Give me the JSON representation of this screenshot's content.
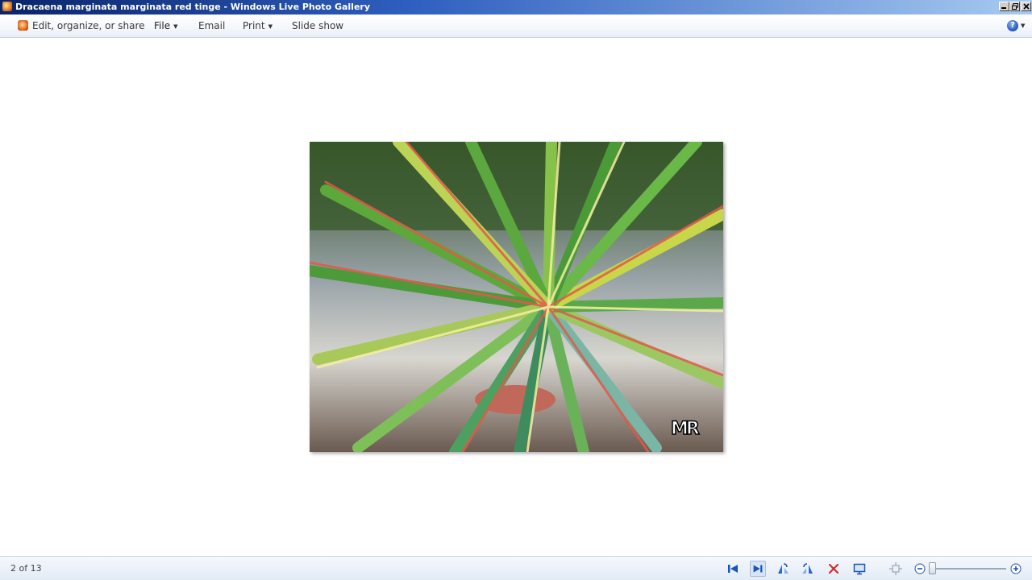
{
  "window": {
    "title": "Dracaena marginata marginata red tinge - Windows Live Photo Gallery"
  },
  "menu": {
    "edit_organize_share": "Edit, organize, or share",
    "file": "File",
    "email": "Email",
    "print": "Print",
    "slide_show": "Slide show",
    "help": "?"
  },
  "photo": {
    "watermark": "MR"
  },
  "status": {
    "counter": "2 of 13"
  },
  "toolbar": {
    "icons": [
      "previous-icon",
      "next-icon",
      "rotate-counterclockwise-icon",
      "rotate-clockwise-icon",
      "delete-icon",
      "play-slideshow-icon",
      "actual-size-icon",
      "zoom-out-icon",
      "zoom-in-icon"
    ],
    "zoom_level": 0
  },
  "colors": {
    "titlebar_start": "#0a246a",
    "titlebar_end": "#a6caf0",
    "nav_blue": "#1a56b8",
    "delete_red": "#d42a2a"
  }
}
